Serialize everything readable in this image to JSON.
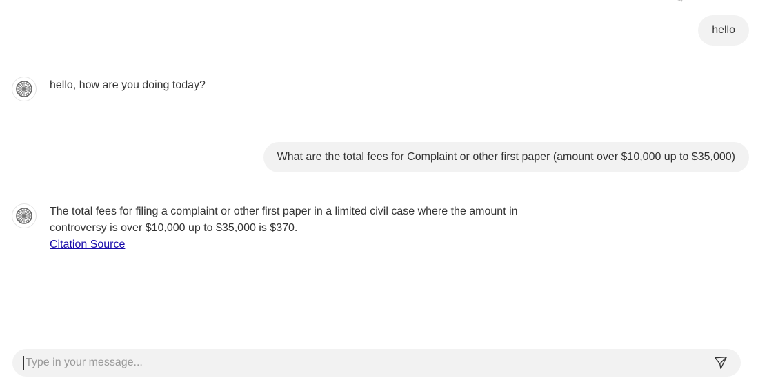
{
  "conversation": {
    "messages": [
      {
        "role": "user",
        "text": "hello"
      },
      {
        "role": "assistant",
        "text": "hello, how are you doing today?"
      },
      {
        "role": "user",
        "text": "What are the total fees for Complaint or other first paper (amount over $10,000 up to $35,000)"
      },
      {
        "role": "assistant",
        "text": "The total fees for filing a complaint or other first paper in a limited civil case where the amount in controversy is over $10,000 up to $35,000 is $370.",
        "link": "Citation Source"
      }
    ]
  },
  "assistant_avatar_icon": "wheel-icon",
  "send_icon": "paper-plane-icon",
  "composer": {
    "placeholder": "Type in your message..."
  },
  "colors": {
    "bubble_bg": "#f2f2f2",
    "link": "#1a0dab",
    "text": "#333333"
  }
}
